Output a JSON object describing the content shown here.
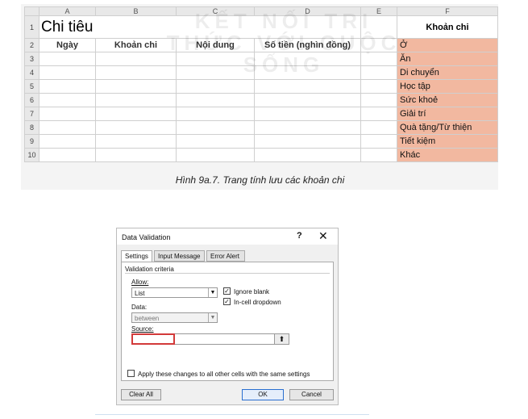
{
  "sheet": {
    "col_headers": [
      "A",
      "B",
      "C",
      "D",
      "E",
      "F"
    ],
    "row_numbers": [
      "1",
      "2",
      "3",
      "4",
      "5",
      "6",
      "7",
      "8",
      "9",
      "10"
    ],
    "title": "Chi tiêu",
    "headers": [
      "Ngày",
      "Khoản chi",
      "Nội dung",
      "Số tiền (nghìn đồng)"
    ],
    "category_header": "Khoản chi",
    "categories": [
      "Ở",
      "Ăn",
      "Di chuyển",
      "Học tập",
      "Sức khoẻ",
      "Giải trí",
      "Quà tặng/Từ thiện",
      "Tiết kiệm",
      "Khác"
    ],
    "category_color": "#f2b8a0",
    "watermark": "KẾT NỐI TRI THỨC VỚI CUỘC SỐNG"
  },
  "caption": "Hình 9a.7. Trang tính lưu các khoản chi",
  "dialog": {
    "title": "Data Validation",
    "help_glyph": "?",
    "close_glyph": "✕",
    "tabs": [
      "Settings",
      "Input Message",
      "Error Alert"
    ],
    "section_title": "Validation criteria",
    "allow_label": "Allow:",
    "allow_value": "List",
    "data_label": "Data:",
    "data_value": "between",
    "ignore_blank_label": "Ignore blank",
    "ignore_blank_checked": true,
    "incell_label": "In-cell dropdown",
    "incell_checked": true,
    "source_label": "Source:",
    "source_value": "",
    "apply_all_label": "Apply these changes to all other cells with the same settings",
    "apply_all_checked": false,
    "clear_all_label": "Clear All",
    "ok_label": "OK",
    "cancel_label": "Cancel",
    "accent_color": "#2a6fd0"
  }
}
